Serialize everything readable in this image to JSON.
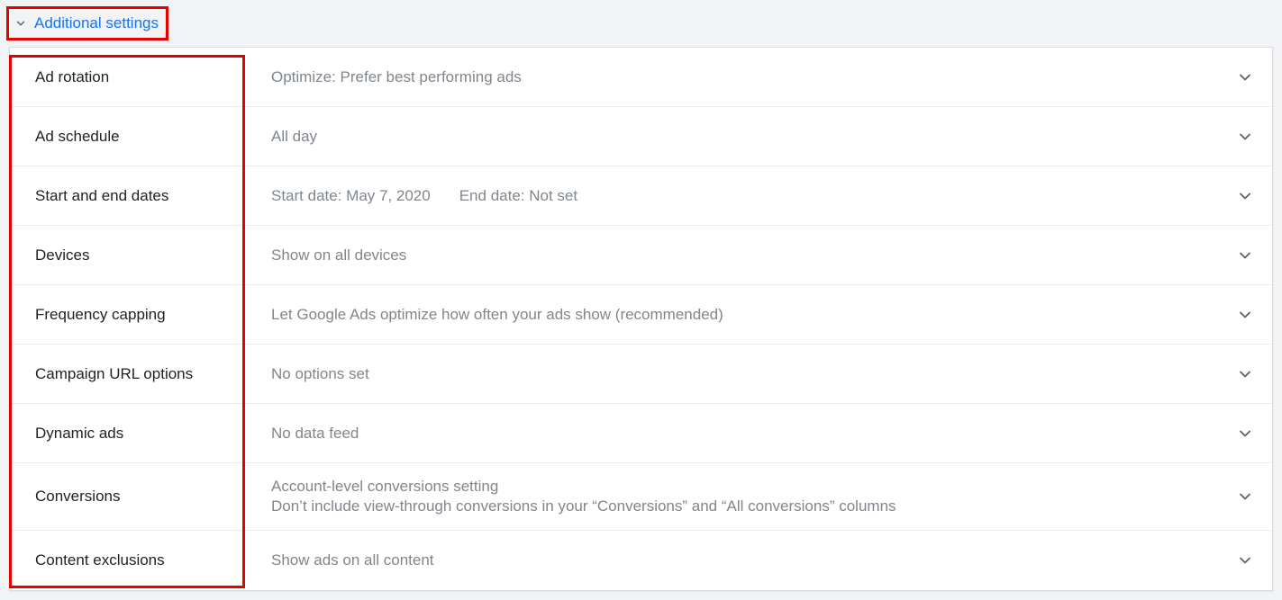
{
  "header": {
    "label": "Additional settings"
  },
  "rows": [
    {
      "label": "Ad rotation",
      "value": "Optimize: Prefer best performing ads"
    },
    {
      "label": "Ad schedule",
      "value": "All day"
    },
    {
      "label": "Start and end dates",
      "start_label": "Start date: May 7, 2020",
      "end_label": "End date: Not set"
    },
    {
      "label": "Devices",
      "value": "Show on all devices"
    },
    {
      "label": "Frequency capping",
      "value": "Let Google Ads optimize how often your ads show (recommended)"
    },
    {
      "label": "Campaign URL options",
      "value": "No options set"
    },
    {
      "label": "Dynamic ads",
      "value": "No data feed"
    },
    {
      "label": "Conversions",
      "line1": "Account-level conversions setting",
      "line2": "Don’t include view-through conversions in your “Conversions” and “All conversions” columns"
    },
    {
      "label": "Content exclusions",
      "value": "Show ads on all content"
    }
  ]
}
